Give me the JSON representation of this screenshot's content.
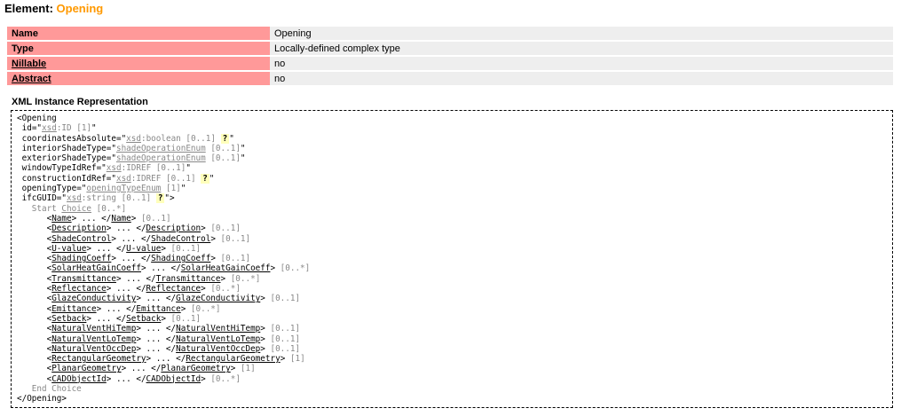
{
  "header": {
    "prefix": "Element: ",
    "name": "Opening"
  },
  "properties": [
    {
      "key": "Name",
      "value": "Opening"
    },
    {
      "key": "Type",
      "value": "Locally-defined complex type"
    },
    {
      "key": "Nillable",
      "value": "no"
    },
    {
      "key": "Abstract",
      "value": "no"
    }
  ],
  "xml": {
    "title": "XML Instance Representation",
    "open_tag": "<Opening",
    "attributes": [
      {
        "name": "id",
        "type_ns": "xsd",
        "type_name": "ID",
        "occ": "[1]",
        "help": false
      },
      {
        "name": "coordinatesAbsolute",
        "type_ns": "xsd",
        "type_name": "boolean",
        "occ": "[0..1]",
        "help": true
      },
      {
        "name": "interiorShadeType",
        "type_ns": "",
        "type_name": "shadeOperationEnum",
        "occ": "[0..1]",
        "help": false
      },
      {
        "name": "exteriorShadeType",
        "type_ns": "",
        "type_name": "shadeOperationEnum",
        "occ": "[0..1]",
        "help": false
      },
      {
        "name": "windowTypeIdRef",
        "type_ns": "xsd",
        "type_name": "IDREF",
        "occ": "[0..1]",
        "help": false
      },
      {
        "name": "constructionIdRef",
        "type_ns": "xsd",
        "type_name": "IDREF",
        "occ": "[0..1]",
        "help": true
      },
      {
        "name": "openingType",
        "type_ns": "",
        "type_name": "openingTypeEnum",
        "occ": "[1]",
        "help": false
      },
      {
        "name": "ifcGUID",
        "type_ns": "xsd",
        "type_name": "string",
        "occ": "[0..1]",
        "help": true,
        "close": true
      }
    ],
    "help_symbol": "?",
    "choice_start": "Start",
    "choice_word": "Choice",
    "choice_occ": "[0..*]",
    "children": [
      {
        "name": "Name",
        "occ": "[0..1]"
      },
      {
        "name": "Description",
        "occ": "[0..1]"
      },
      {
        "name": "ShadeControl",
        "occ": "[0..1]"
      },
      {
        "name": "U-value",
        "occ": "[0..1]"
      },
      {
        "name": "ShadingCoeff",
        "occ": "[0..1]"
      },
      {
        "name": "SolarHeatGainCoeff",
        "occ": "[0..*]"
      },
      {
        "name": "Transmittance",
        "occ": "[0..*]"
      },
      {
        "name": "Reflectance",
        "occ": "[0..*]"
      },
      {
        "name": "GlazeConductivity",
        "occ": "[0..1]"
      },
      {
        "name": "Emittance",
        "occ": "[0..*]"
      },
      {
        "name": "Setback",
        "occ": "[0..1]"
      },
      {
        "name": "NaturalVentHiTemp",
        "occ": "[0..1]"
      },
      {
        "name": "NaturalVentLoTemp",
        "occ": "[0..1]"
      },
      {
        "name": "NaturalVentOccDep",
        "occ": "[0..1]"
      },
      {
        "name": "RectangularGeometry",
        "occ": "[1]"
      },
      {
        "name": "PlanarGeometry",
        "occ": "[1]"
      },
      {
        "name": "CADObjectId",
        "occ": "[0..*]"
      }
    ],
    "choice_end": "End Choice",
    "close_tag": "</Opening>"
  }
}
